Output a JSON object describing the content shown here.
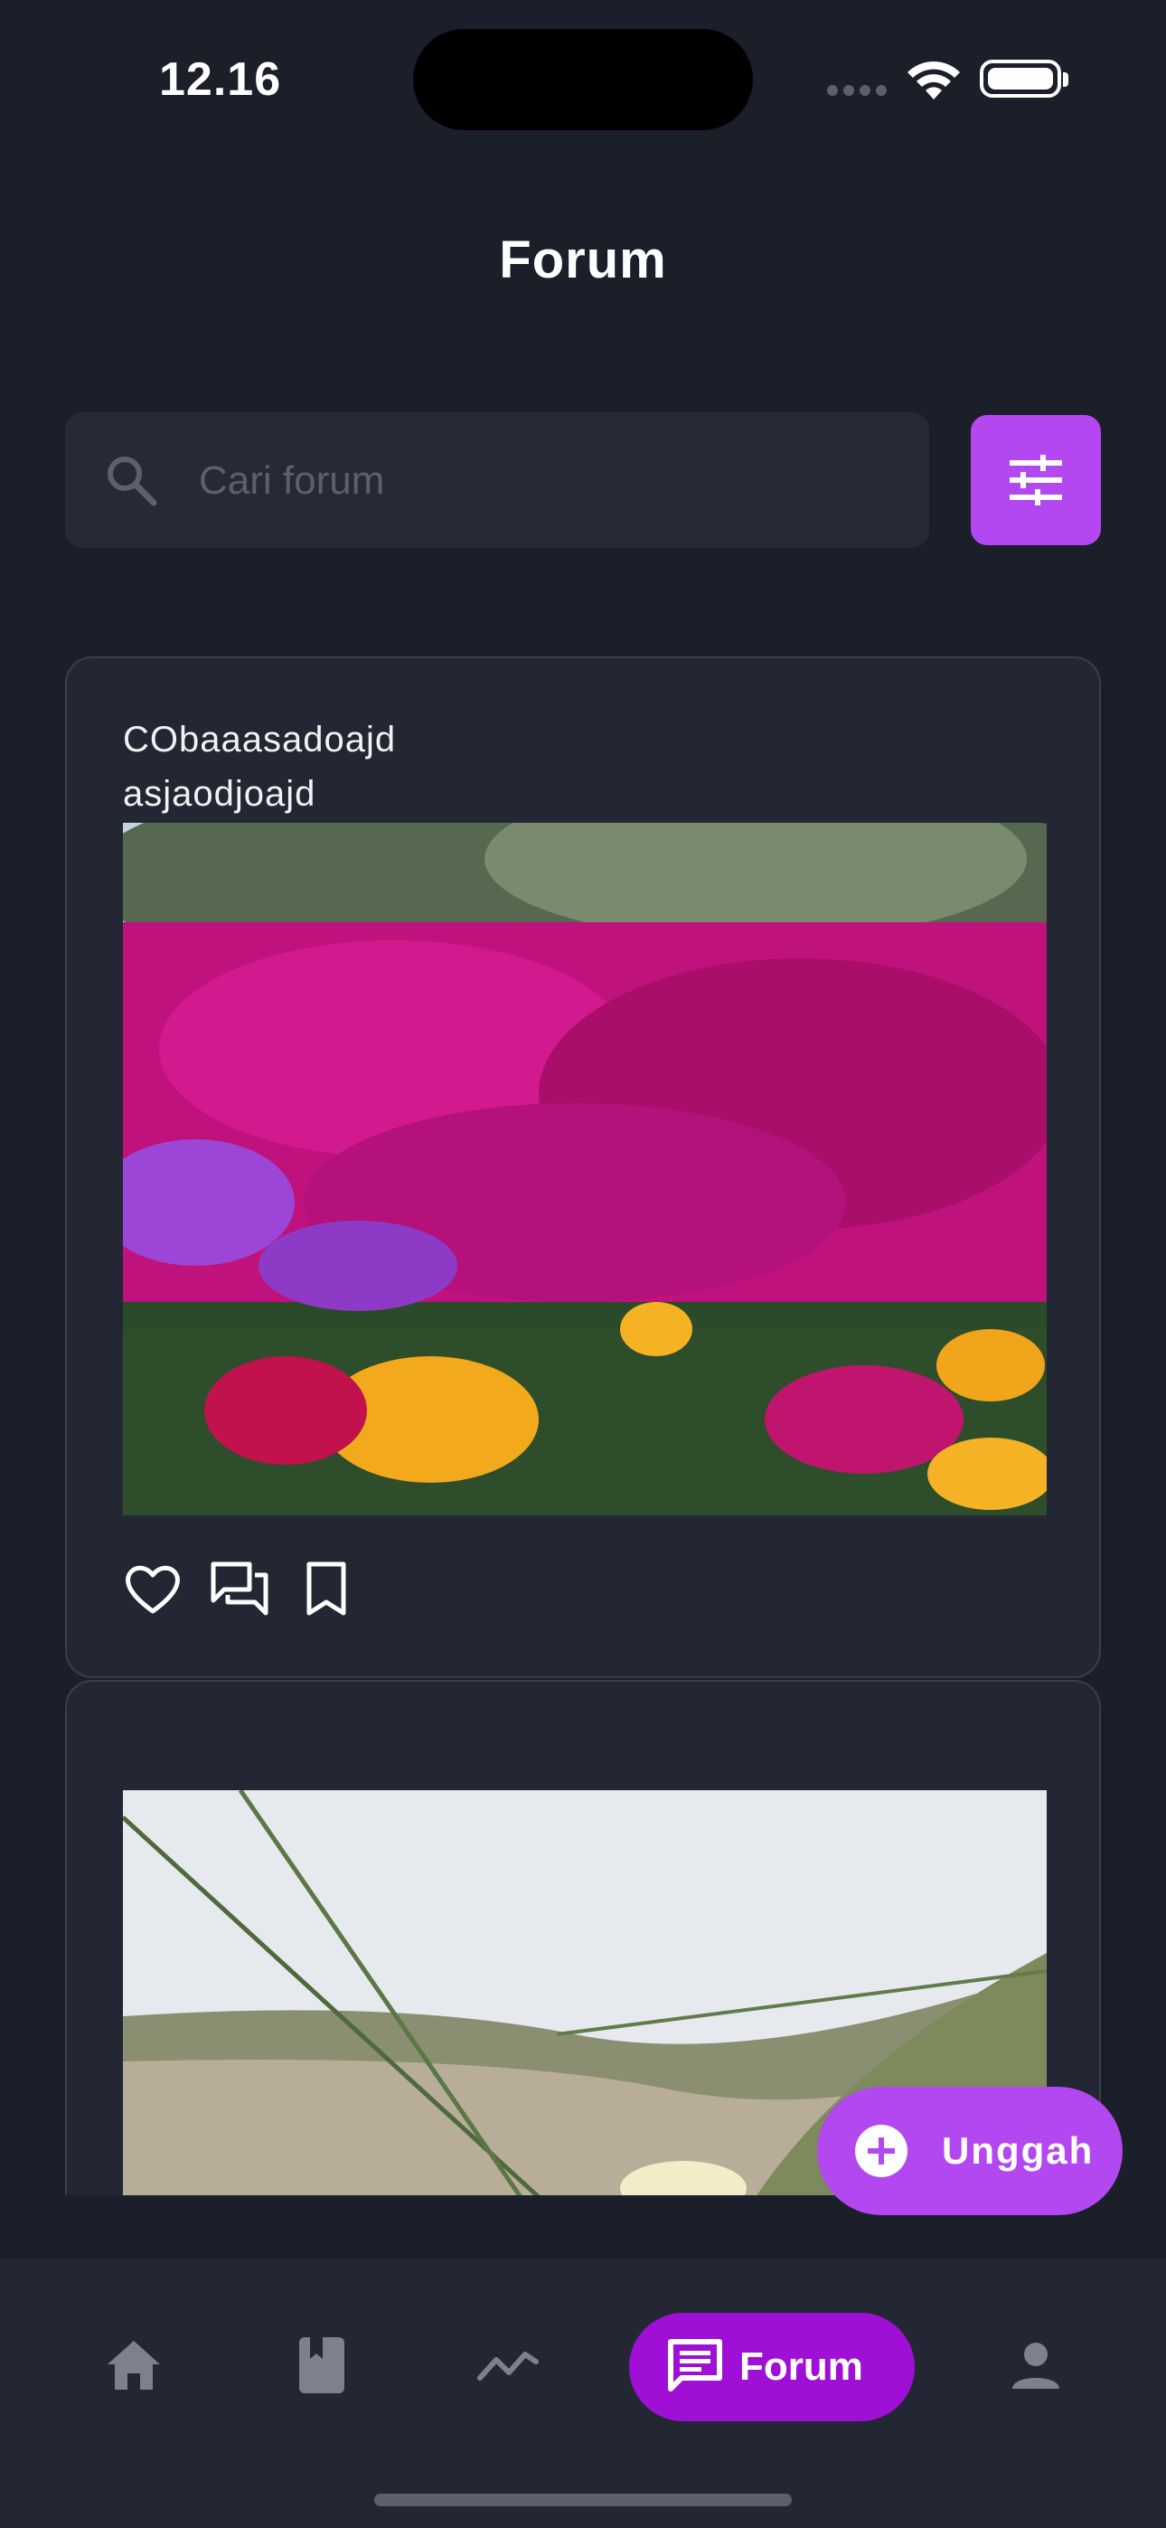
{
  "status_bar": {
    "time": "12.16"
  },
  "header": {
    "title": "Forum"
  },
  "search": {
    "placeholder": "Cari forum"
  },
  "posts": [
    {
      "text": "CObaaasadoajd\nasjaodjoajd",
      "image": "magenta and purple ice plant flowers with yellow blooms"
    },
    {
      "text": "",
      "image": "beach dune grass against pale sky"
    }
  ],
  "fab": {
    "label": "Unggah",
    "icon": "plus-circle-icon"
  },
  "bottom_nav": {
    "items": [
      {
        "icon": "home-icon"
      },
      {
        "icon": "book-icon"
      },
      {
        "icon": "trend-chart-icon"
      },
      {
        "icon": "forum-icon",
        "label": "Forum",
        "active": true
      },
      {
        "icon": "person-icon"
      }
    ]
  },
  "colors": {
    "background": "#1b1f2a",
    "card": "#232734",
    "accent": "#b347f0",
    "nav_active": "#9f0fd6"
  }
}
